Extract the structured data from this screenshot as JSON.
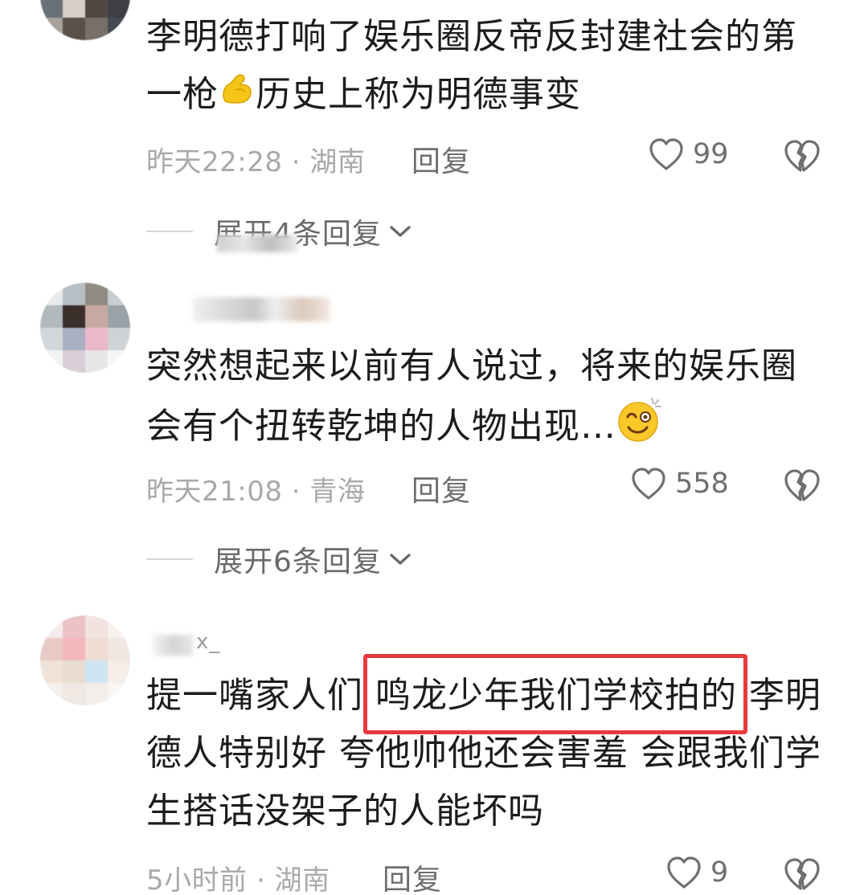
{
  "comments": [
    {
      "body_line1": "李明德打响了娱乐圈反帝反封建社会的第",
      "body_line2_a": "一枪",
      "emoji": "flexed-biceps",
      "body_line2_b": "历史上称为明德事变",
      "time": "昨天22:28",
      "region": "湖南",
      "reply_label": "回复",
      "like_count": "99",
      "expand_label": "展开4条回复"
    },
    {
      "body_line1": "突然想起来以前有人说过，将来的娱乐圈",
      "body_line2_a": "会有个扭转乾坤的人物出现…",
      "emoji": "dizzy-smile",
      "time": "昨天21:08",
      "region": "青海",
      "reply_label": "回复",
      "like_count": "558",
      "expand_label": "展开6条回复"
    },
    {
      "username_visible": "x_",
      "body_line1_a": "提一嘴家人们",
      "body_line1_highlight": "鸣龙少年我们学校拍的",
      "body_line1_b": "李明",
      "body_line2": "德人特别好 夸他帅他还会害羞 会跟我们学",
      "body_line3": "生搭话没架子的人能坏吗",
      "time": "5小时前",
      "region": "湖南",
      "reply_label": "回复",
      "like_count": "9"
    }
  ],
  "meta_separator": " · ",
  "colors": {
    "highlight_border": "#e8393d",
    "meta_text": "#a9a9a9",
    "body_text": "#1c1c1c"
  }
}
